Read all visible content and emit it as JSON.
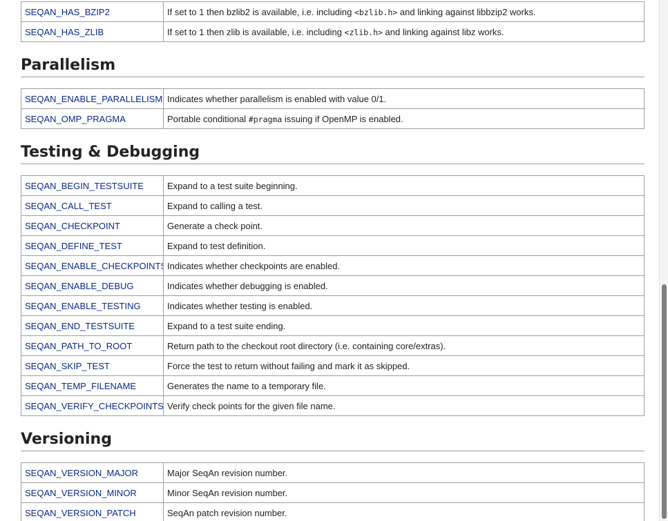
{
  "top_table": [
    {
      "name": "SEQAN_HAS_BZIP2",
      "desc_pre": "If set to 1 then bzlib2 is available, i.e. including ",
      "code": "<bzlib.h>",
      "desc_post": " and linking against libbzip2 works."
    },
    {
      "name": "SEQAN_HAS_ZLIB",
      "desc_pre": "If set to 1 then zlib is available, i.e. including ",
      "code": "<zlib.h>",
      "desc_post": " and linking against libz works."
    }
  ],
  "sections": {
    "parallelism": {
      "title": "Parallelism",
      "rows": [
        {
          "name": "SEQAN_ENABLE_PARALLELISM",
          "desc": "Indicates whether parallelism is enabled with value 0/1."
        },
        {
          "name": "SEQAN_OMP_PRAGMA",
          "desc_pre": "Portable conditional ",
          "code": "#pragma",
          "desc_post": " issuing if OpenMP is enabled."
        }
      ]
    },
    "testing": {
      "title": "Testing & Debugging",
      "rows": [
        {
          "name": "SEQAN_BEGIN_TESTSUITE",
          "desc": "Expand to a test suite beginning."
        },
        {
          "name": "SEQAN_CALL_TEST",
          "desc": "Expand to calling a test."
        },
        {
          "name": "SEQAN_CHECKPOINT",
          "desc": "Generate a check point."
        },
        {
          "name": "SEQAN_DEFINE_TEST",
          "desc": "Expand to test definition."
        },
        {
          "name": "SEQAN_ENABLE_CHECKPOINTS",
          "desc": "Indicates whether checkpoints are enabled."
        },
        {
          "name": "SEQAN_ENABLE_DEBUG",
          "desc": "Indicates whether debugging is enabled."
        },
        {
          "name": "SEQAN_ENABLE_TESTING",
          "desc": "Indicates whether testing is enabled."
        },
        {
          "name": "SEQAN_END_TESTSUITE",
          "desc": "Expand to a test suite ending."
        },
        {
          "name": "SEQAN_PATH_TO_ROOT",
          "desc": "Return path to the checkout root directory (i.e. containing core/extras)."
        },
        {
          "name": "SEQAN_SKIP_TEST",
          "desc": "Force the test to return without failing and mark it as skipped."
        },
        {
          "name": "SEQAN_TEMP_FILENAME",
          "desc": "Generates the name to a temporary file."
        },
        {
          "name": "SEQAN_VERIFY_CHECKPOINTS",
          "desc": "Verify check points for the given file name."
        }
      ]
    },
    "versioning": {
      "title": "Versioning",
      "rows": [
        {
          "name": "SEQAN_VERSION_MAJOR",
          "desc": "Major SeqAn revision number."
        },
        {
          "name": "SEQAN_VERSION_MINOR",
          "desc": "Minor SeqAn revision number."
        },
        {
          "name": "SEQAN_VERSION_PATCH",
          "desc": "SeqAn patch revision number."
        }
      ]
    }
  }
}
